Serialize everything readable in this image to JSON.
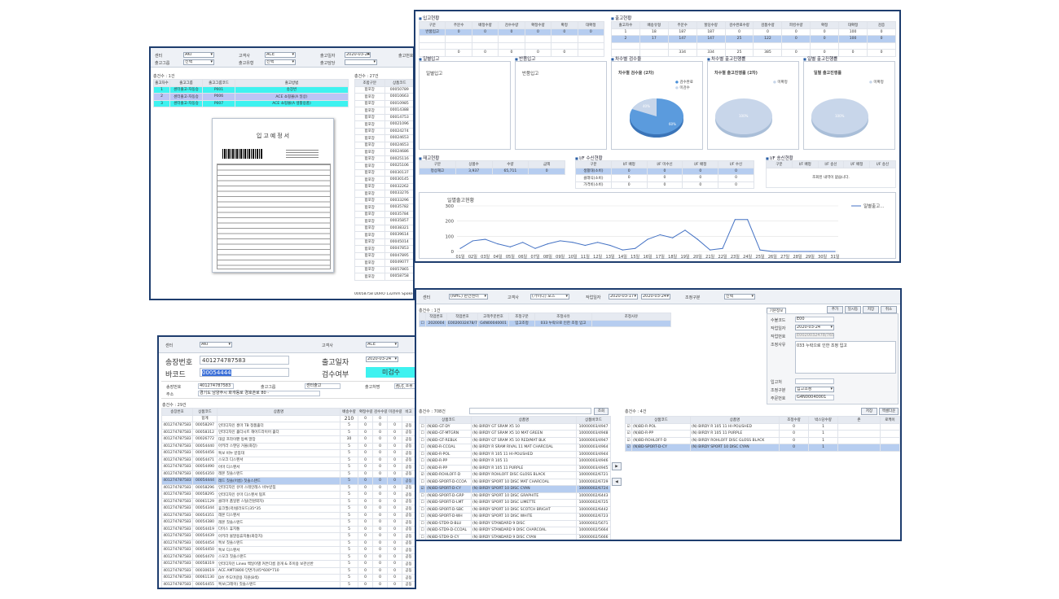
{
  "w1": {
    "f1_label": "센터",
    "f1_val": "AKI",
    "f2_label": "고객사",
    "f2_val": "ACE",
    "f3_label": "출고일자",
    "f3_val": "2020-03-24",
    "f4_label": "출고번호",
    "f5_label": "출고그룹",
    "f5_val": "선택",
    "f6_label": "출고유형",
    "f6_val": "선택",
    "f7_label": "출고담당",
    "count": "총건수 : 1건",
    "headers": [
      "출고차수",
      "출고그룹",
      "출고그룹코드",
      "출고방법"
    ],
    "rows": [
      [
        "1",
        "센터출고-자동승",
        "P001",
        "송장번"
      ],
      [
        "2",
        "센터출고-자동승",
        "P006",
        "ACE 쇼핑몰(A 일상)"
      ],
      [
        "3",
        "센터출고-자동승",
        "P007",
        "ACE 쇼핑몰(A 생활용품)"
      ]
    ],
    "right_count": "총건수 : 27건",
    "right_headers": [
      "조합구분",
      "상품코드"
    ],
    "right_rows": [
      [
        "합포장",
        "00050789"
      ],
      [
        "합포장",
        "00010663"
      ],
      [
        "합포장",
        "00010985"
      ],
      [
        "합포장",
        "00014388"
      ],
      [
        "합포장",
        "00014753"
      ],
      [
        "합포장",
        "00021096"
      ],
      [
        "합포장",
        "00024274"
      ],
      [
        "합포장",
        "00024653"
      ],
      [
        "합포장",
        "00024653"
      ],
      [
        "합포장",
        "00024686"
      ],
      [
        "합포장",
        "00025116"
      ],
      [
        "합포장",
        "00025106"
      ],
      [
        "합포장",
        "00030137"
      ],
      [
        "합포장",
        "00030145"
      ],
      [
        "합포장",
        "00032262"
      ],
      [
        "합포장",
        "00033276"
      ],
      [
        "합포장",
        "00033296"
      ],
      [
        "합포장",
        "00035782"
      ],
      [
        "합포장",
        "00035784"
      ],
      [
        "합포장",
        "00035857"
      ],
      [
        "합포장",
        "00038321"
      ],
      [
        "합포장",
        "00039614"
      ],
      [
        "합포장",
        "00045014"
      ],
      [
        "합포장",
        "00047853"
      ],
      [
        "합포장",
        "00047895"
      ],
      [
        "합포장",
        "00049077"
      ],
      [
        "합포장",
        "00057865"
      ],
      [
        "합포장",
        "00058758"
      ]
    ],
    "doc_title": "입고예정서",
    "bottom_code": "00058758",
    "bottom_name": "DURO 132mm Spoke 18036",
    "bottom_q1": "10",
    "bottom_q2": "10"
  },
  "w2": {
    "s1": "입고현황",
    "s1_headers": [
      "구분",
      "주문수",
      "배정수량",
      "검수수량",
      "확정수량",
      "확정",
      "대확정"
    ],
    "s1_row": [
      "반품입고",
      "0",
      "0",
      "0",
      "0",
      "0",
      "0"
    ],
    "s1_total": [
      "",
      "0",
      "0",
      "0",
      "0",
      "0"
    ],
    "s2": "출고현황",
    "s2_headers": [
      "출고차수",
      "배송유형",
      "주문수",
      "할당수량",
      "검수완료수량",
      "검품수량",
      "피킹수량",
      "확정",
      "대확정",
      "검증"
    ],
    "s2_rows": [
      [
        "1",
        "18",
        "187",
        "187",
        "0",
        "0",
        "0",
        "0",
        "100",
        "0"
      ],
      [
        "2",
        "17",
        "147",
        "147",
        "25",
        "122",
        "0",
        "0",
        "100",
        "0"
      ]
    ],
    "s2_total": [
      "",
      "",
      "334",
      "334",
      "25",
      "385",
      "0",
      "0",
      "0",
      "0"
    ],
    "p1": "일별입고",
    "p1_t": "일별입고",
    "p2": "반품입고",
    "p2_t": "반품입고",
    "p3": "차수별 검수율",
    "p3_t": "차수별 검수율 (2차)",
    "p3_l1": "검수완료",
    "p3_l2": "미검수",
    "p3_v1": "60%",
    "p3_v2": "40%",
    "p4": "차수별 출고진행률",
    "p4_t": "차수별 출고진행률 (2차)",
    "p4_l1": "미확정",
    "p4_v": "100%",
    "p5": "일별 출고진행률",
    "p5_t": "일별 출고진행률",
    "p5_l1": "미확정",
    "p5_v": "100%",
    "s3": "재고현황",
    "s3_headers": [
      "구분",
      "상품수",
      "수량",
      "금액"
    ],
    "s3_row": [
      "정상재고",
      "3,937",
      "65,711",
      "0"
    ],
    "s4": "I/F 수신현황",
    "s4_headers": [
      "구분",
      "I/F 배정",
      "I/F 미수신",
      "I/F 배정",
      "I/F 수신"
    ],
    "s4_rows": [
      [
        "생활대(소비)",
        "0",
        "0",
        "0",
        "0"
      ],
      [
        "클래식(소비)",
        "0",
        "0",
        "0",
        "0"
      ],
      [
        "가격비(소비)",
        "0",
        "0",
        "0",
        "0"
      ]
    ],
    "s5": "I/F 송신현황",
    "s5_headers": [
      "구분",
      "I/F 배정",
      "I/F 송신",
      "I/F 배정",
      "I/F 송신"
    ],
    "s5_empty": "조회된 내역이 없습니다.",
    "chart_title": "일별출고현황",
    "chart_legend": "일별출고..."
  },
  "chart_data": {
    "type": "line",
    "title": "일별출고현황",
    "xlabel": "",
    "ylabel": "",
    "categories": [
      "01일",
      "02일",
      "03일",
      "04일",
      "05일",
      "06일",
      "07일",
      "08일",
      "09일",
      "10일",
      "11일",
      "12일",
      "13일",
      "14일",
      "15일",
      "16일",
      "17일",
      "18일",
      "19일",
      "20일",
      "21일",
      "22일",
      "23일",
      "24일",
      "25일",
      "26일",
      "27일",
      "28일",
      "29일",
      "30일",
      "31일"
    ],
    "series": [
      {
        "name": "일별출고...",
        "values": [
          20,
          70,
          80,
          50,
          30,
          60,
          20,
          50,
          70,
          60,
          40,
          60,
          40,
          10,
          20,
          80,
          110,
          90,
          140,
          80,
          10,
          20,
          210,
          210,
          10,
          0,
          0,
          0,
          0,
          0,
          0
        ]
      }
    ],
    "ylim": [
      0,
      300
    ],
    "yticks": [
      0,
      100,
      200,
      300
    ],
    "grid": true,
    "legend": "right"
  },
  "w3": {
    "f1_label": "센터",
    "f1_val": "AKI",
    "f2_label": "고객사",
    "f2_val": "ACE",
    "l_inv": "송장번호",
    "v_inv": "401274787583",
    "l_bar": "바코드",
    "v_bar": "00054444",
    "l_date": "출고일자",
    "v_date": "2020-03-24",
    "l_chk": "검수여부",
    "v_chk": "미검수",
    "r1_a": "송장번호",
    "r1_av": "401274787583",
    "r1_b": "출고그룹",
    "r1_bv": "센터출고",
    "r1_c": "출고처명",
    "r1_cv": "ACE 쇼핑몰(A)",
    "r2_a": "주소",
    "r2_av": "경기도 남양주시 화개동로 경호촌로 80 -",
    "count": "총건수 : 29건",
    "headers": [
      "송장번호",
      "상품코드",
      "상품명",
      "배송수량",
      "확정수량",
      "검수수량",
      "미검수량",
      "비고"
    ],
    "sum_row": [
      "",
      "합계",
      "",
      "210",
      "0",
      "0",
      "",
      ""
    ],
    "rows": [
      [
        "401274787583",
        "00058297",
        "인터디자인 홍마 TB 정품홀더",
        "5",
        "0",
        "0",
        "공동"
      ],
      [
        "401274787583",
        "00058312",
        "인터디자인 홀더시트 해어드라이어 홀더",
        "5",
        "0",
        "0",
        "공동"
      ],
      [
        "401274787583",
        "00026772",
        "대길 프라이팬 등록 말장",
        "30",
        "0",
        "0",
        "공동"
      ],
      [
        "401274787583",
        "00054440",
        "아키라 스텐딩 거울(화장)",
        "5",
        "0",
        "0",
        "공동"
      ],
      [
        "401274787583",
        "00054456",
        "톡보 비누 받침대",
        "5",
        "0",
        "0",
        "공동"
      ],
      [
        "401274787583",
        "00054471",
        "스모크 디스펜서",
        "5",
        "0",
        "0",
        "공동"
      ],
      [
        "401274787583",
        "00054490",
        "아마 디스펜서",
        "5",
        "0",
        "0",
        "공동"
      ],
      [
        "401274787583",
        "00054350",
        "레몬 칫솔스탠드",
        "5",
        "0",
        "0",
        "공동"
      ],
      [
        "401274787583",
        "00054444",
        "레드 칫솔(어름) 칫솔스탠드",
        "5",
        "0",
        "0",
        "공동"
      ],
      [
        "401274787583",
        "00058296",
        "인터디자인 유마 스테인레스 비누받침",
        "5",
        "0",
        "0",
        "공동"
      ],
      [
        "401274787583",
        "00058295",
        "인터디자인 유마 디스펜서 펌프",
        "5",
        "0",
        "0",
        "공동"
      ],
      [
        "401274787583",
        "00061129",
        "클리어 품일핀 스틸(전원외자)",
        "5",
        "0",
        "0",
        "공동"
      ],
      [
        "401274787583",
        "00054344",
        "휴크필(곽)빌라모드(35*35",
        "5",
        "0",
        "0",
        "공동"
      ],
      [
        "401274787583",
        "00054351",
        "레몬 디스펜서",
        "5",
        "0",
        "0",
        "공동"
      ],
      [
        "401274787583",
        "00054380",
        "레몬 칫솔스탠드",
        "5",
        "0",
        "0",
        "공동"
      ],
      [
        "401274787583",
        "00054419",
        "다이스 휴지통",
        "5",
        "0",
        "0",
        "공동"
      ],
      [
        "401274787583",
        "00054439",
        "아키라 물말용휴지통(화장지)",
        "5",
        "0",
        "0",
        "공동"
      ],
      [
        "401274787583",
        "00054454",
        "톡보 칫솔스탠드",
        "5",
        "0",
        "0",
        "공동"
      ],
      [
        "401274787583",
        "00054450",
        "톡보 디스펜서",
        "5",
        "0",
        "0",
        "공동"
      ],
      [
        "401274787583",
        "00054470",
        "스모크 칫솔스탠드",
        "5",
        "0",
        "0",
        "공동"
      ],
      [
        "401274787583",
        "00058319",
        "인터디자인 Lineo 백일이별 커튼다름 걸개 & 조이용 보관선반",
        "5",
        "0",
        "0",
        "공동"
      ],
      [
        "401274787583",
        "00030619",
        "ACE AMT0800 단면기(45*600*710",
        "5",
        "0",
        "0",
        "공동"
      ],
      [
        "401274787583",
        "00061130",
        "DIY 주도머갈용 지원(8색)",
        "5",
        "0",
        "0",
        "공동"
      ],
      [
        "401274787583",
        "00054455",
        "톡보(그레이) 칫솔스탠드",
        "5",
        "0",
        "0",
        "공동"
      ]
    ]
  },
  "w4": {
    "f1_label": "센터",
    "f1_val": "(NHC) 판건센터",
    "f2_label": "고객사",
    "f2_val": "(가이디) 포츠",
    "f3_label": "작업일자",
    "f3_a": "2020-03-17",
    "f3_b": "2020-03-24",
    "f4_label": "조정구분",
    "f4_val": "선택",
    "count": "총건수 : 1건",
    "headers": [
      "",
      "작업번호",
      "작업번호",
      "고객주문번호",
      "조정구분",
      "조정사유",
      "조정사유"
    ],
    "row": [
      "",
      "2020004",
      "E0020032478/765",
      "G4N00040001",
      "입고조정",
      "033 누락으로 인한 조정 입고",
      ""
    ],
    "tabs": [
      "기본정보"
    ],
    "btns": [
      "추가",
      "일시등",
      "저장",
      "취소"
    ],
    "k1": "수불코드",
    "k1v": "E00",
    "k2": "작업일자",
    "k2v": "2020-03-24",
    "k3": "작업번호",
    "k3v": "E0020032478/765",
    "k4": "조정사유",
    "k4v": "033 누락으로 인한 조정 입고",
    "k5": "입고처",
    "k6": "조정구분",
    "k6v": "입고조정",
    "k7": "주문번호",
    "k7v": "G4N00040001",
    "l_count": "총건수 : 708건",
    "l_btn": "조회",
    "l_headers": [
      "",
      "상품코드",
      "상품명",
      "상품바코드"
    ],
    "l_rows": [
      [
        "(N)BD-GT-DY",
        "(N) BIRDY GT SRAM X5 10",
        "10000003/4947"
      ],
      [
        "(N)BD-GT-MTGRN",
        "(N) BIRDY GT SRAM X5 10 MAT GREEN",
        "10000003/4948"
      ],
      [
        "(N)BD-GT-REBLK",
        "(N) BIRDY GT SRAM X5 10 RED/MAT BLK",
        "10000003/4947"
      ],
      [
        "(N)BD-R-CCOAL",
        "(N) BIRDY R SRAM RIVAL 11 MAT CHARCOAL",
        "10000003/4964"
      ],
      [
        "(N)BD-R-POL",
        "(N) BIRDY R 105 11 HI-POLISHED",
        "10000003/4944"
      ],
      [
        "(N)BD-R-PP",
        "(N) BIRDY R 105 11",
        "10000003/4946"
      ],
      [
        "(N)BD-R-PP",
        "(N) BIRDY R 105 11 PURPLE",
        "10000003/4945"
      ],
      [
        "(N)BD-ROHLOFF-D",
        "(N) BIRDY ROHLOFF DISC GLOSS BLACK",
        "10000002/6721"
      ],
      [
        "(N)BD-SPORT-D-CCOA",
        "(N) BIRDY SPORT 10 DISC MAT CHARCOAL",
        "10000002/6729"
      ],
      [
        "(N)BD-SPORT-D-CY",
        "(N) BIRDY SPORT 10 DISC CYAN",
        "10000002/6724"
      ],
      [
        "(N)BD-SPORT-D-GRP",
        "(N) BIRDY SPORT 10 DISC GRAPHITE",
        "10000002/6443"
      ],
      [
        "(N)BD-SPORT-D-LMT",
        "(N) BIRDY SPORT 10 DISC LIMETTE",
        "10000002/6725"
      ],
      [
        "(N)BD-SPORT-D-SBC",
        "(N) BIRDY SPORT 10 DISC SCOTCH BRIGHT",
        "10000002/6442"
      ],
      [
        "(N)BD-SPORT-D-WH",
        "(N) BIRDY SPORT 10 DISC WHITE",
        "10000002/6723"
      ],
      [
        "(N)BD-STD9-D-BLU",
        "(N) BIRDY STANDARD 9 DISC",
        "10000002/5671"
      ],
      [
        "(N)BD-STD9-D-CCOAL",
        "(N) BIRDY STANDARD 9 DISC CHARCOAL",
        "10000002/5664"
      ],
      [
        "(N)BD-STD9-D-CY",
        "(N) BIRDY STANDARD 9 DISC CYAN",
        "10000002/5666"
      ]
    ],
    "r_count": "총건수 : 4건",
    "r_btns": [
      "저장",
      "엑셀다운"
    ],
    "r_headers": [
      "",
      "상품코드",
      "상품명",
      "조정수량",
      "박스당수량",
      "존",
      "로케이"
    ],
    "r_rows": [
      [
        "(N)BD-R-POL",
        "(N) BIRDY R 105 11 HI-POLISHED",
        "0",
        "1"
      ],
      [
        "(N)BD-R-PP",
        "(N) BIRDY R 105 11 PURPLE",
        "0",
        "1"
      ],
      [
        "(N)BD-ROHLOFF-D",
        "(N) BIRDY ROHLOFF DISC GLOSS BLACK",
        "0",
        "1"
      ],
      [
        "(N)BD-SPORT-D-CY",
        "(N) BIRDY SPORT 10 DISC CYAN",
        "0",
        "1"
      ]
    ]
  }
}
